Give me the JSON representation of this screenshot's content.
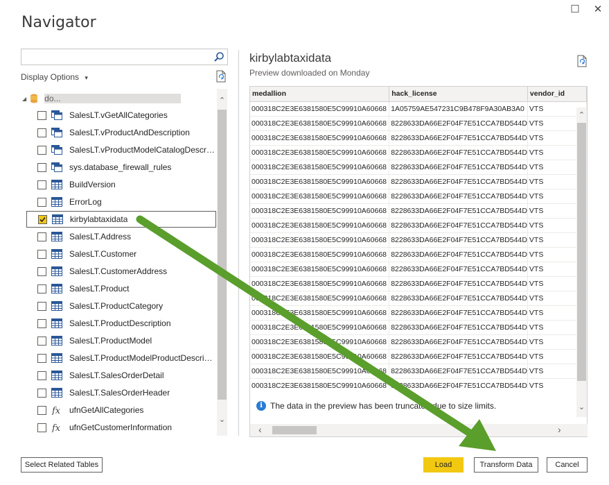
{
  "window": {
    "title": "Navigator",
    "maximize_glyph": "☐",
    "close_glyph": "✕"
  },
  "search": {
    "placeholder": "",
    "value": ""
  },
  "display_options": {
    "label": "Display Options",
    "arrow": "▾"
  },
  "tree": {
    "root_label": "                                                  do...",
    "items": [
      {
        "label": "SalesLT.vGetAllCategories",
        "icon": "view-icon",
        "checked": false
      },
      {
        "label": "SalesLT.vProductAndDescription",
        "icon": "view-icon",
        "checked": false
      },
      {
        "label": "SalesLT.vProductModelCatalogDescrip...",
        "icon": "view-icon",
        "checked": false
      },
      {
        "label": "sys.database_firewall_rules",
        "icon": "view-icon",
        "checked": false
      },
      {
        "label": "BuildVersion",
        "icon": "table-icon",
        "checked": false
      },
      {
        "label": "ErrorLog",
        "icon": "table-icon",
        "checked": false
      },
      {
        "label": "kirbylabtaxidata",
        "icon": "table-icon",
        "checked": true
      },
      {
        "label": "SalesLT.Address",
        "icon": "table-icon",
        "checked": false
      },
      {
        "label": "SalesLT.Customer",
        "icon": "table-icon",
        "checked": false
      },
      {
        "label": "SalesLT.CustomerAddress",
        "icon": "table-icon",
        "checked": false
      },
      {
        "label": "SalesLT.Product",
        "icon": "table-icon",
        "checked": false
      },
      {
        "label": "SalesLT.ProductCategory",
        "icon": "table-icon",
        "checked": false
      },
      {
        "label": "SalesLT.ProductDescription",
        "icon": "table-icon",
        "checked": false
      },
      {
        "label": "SalesLT.ProductModel",
        "icon": "table-icon",
        "checked": false
      },
      {
        "label": "SalesLT.ProductModelProductDescripti...",
        "icon": "table-icon",
        "checked": false
      },
      {
        "label": "SalesLT.SalesOrderDetail",
        "icon": "table-icon",
        "checked": false
      },
      {
        "label": "SalesLT.SalesOrderHeader",
        "icon": "table-icon",
        "checked": false
      },
      {
        "label": "ufnGetAllCategories",
        "icon": "function-icon",
        "checked": false
      },
      {
        "label": "ufnGetCustomerInformation",
        "icon": "function-icon",
        "checked": false
      }
    ]
  },
  "preview": {
    "title": "kirbylabtaxidata",
    "subtitle": "Preview downloaded on Monday",
    "columns": [
      "medallion",
      "hack_license",
      "vendor_id"
    ],
    "rows": [
      [
        "000318C2E3E6381580E5C99910A60668",
        "1A05759AE547231C9B478F9A30AB3A0",
        "VTS"
      ],
      [
        "000318C2E3E6381580E5C99910A60668",
        "8228633DA66E2F04F7E51CCA7BD544D",
        "VTS"
      ],
      [
        "000318C2E3E6381580E5C99910A60668",
        "8228633DA66E2F04F7E51CCA7BD544D",
        "VTS"
      ],
      [
        "000318C2E3E6381580E5C99910A60668",
        "8228633DA66E2F04F7E51CCA7BD544D",
        "VTS"
      ],
      [
        "000318C2E3E6381580E5C99910A60668",
        "8228633DA66E2F04F7E51CCA7BD544D",
        "VTS"
      ],
      [
        "000318C2E3E6381580E5C99910A60668",
        "8228633DA66E2F04F7E51CCA7BD544D",
        "VTS"
      ],
      [
        "000318C2E3E6381580E5C99910A60668",
        "8228633DA66E2F04F7E51CCA7BD544D",
        "VTS"
      ],
      [
        "000318C2E3E6381580E5C99910A60668",
        "8228633DA66E2F04F7E51CCA7BD544D",
        "VTS"
      ],
      [
        "000318C2E3E6381580E5C99910A60668",
        "8228633DA66E2F04F7E51CCA7BD544D",
        "VTS"
      ],
      [
        "000318C2E3E6381580E5C99910A60668",
        "8228633DA66E2F04F7E51CCA7BD544D",
        "VTS"
      ],
      [
        "000318C2E3E6381580E5C99910A60668",
        "8228633DA66E2F04F7E51CCA7BD544D",
        "VTS"
      ],
      [
        "000318C2E3E6381580E5C99910A60668",
        "8228633DA66E2F04F7E51CCA7BD544D",
        "VTS"
      ],
      [
        "000318C2E3E6381580E5C99910A60668",
        "8228633DA66E2F04F7E51CCA7BD544D",
        "VTS"
      ],
      [
        "000318C2E3E6381580E5C99910A60668",
        "8228633DA66E2F04F7E51CCA7BD544D",
        "VTS"
      ],
      [
        "000318C2E3E6381580E5C99910A60668",
        "8228633DA66E2F04F7E51CCA7BD544D",
        "VTS"
      ],
      [
        "000318C2E3E6381580E5C99910A60668",
        "8228633DA66E2F04F7E51CCA7BD544D",
        "VTS"
      ],
      [
        "000318C2E3E6381580E5C99910A60668",
        "8228633DA66E2F04F7E51CCA7BD544D",
        "VTS"
      ],
      [
        "000318C2E3E6381580E5C99910A60668",
        "8228633DA66E2F04F7E51CCA7BD544D",
        "VTS"
      ],
      [
        "000318C2E3E6381580E5C99910A60668",
        "8228633DA66E2F04F7E51CCA7BD544D",
        "VTS"
      ],
      [
        "000318C2E3E6381580E5C99910A60668",
        "8228633DA66E2F04F7E51CCA7BD544D",
        "VTS"
      ]
    ],
    "truncation_note": "The data in the preview has been truncated due to size limits.",
    "info_glyph": "i"
  },
  "buttons": {
    "select_related": "Select Related Tables",
    "load": "Load",
    "transform": "Transform Data",
    "cancel": "Cancel"
  },
  "colors": {
    "accent": "#f2c811",
    "arrow": "#5a9e2c",
    "info": "#2b7cd3"
  }
}
